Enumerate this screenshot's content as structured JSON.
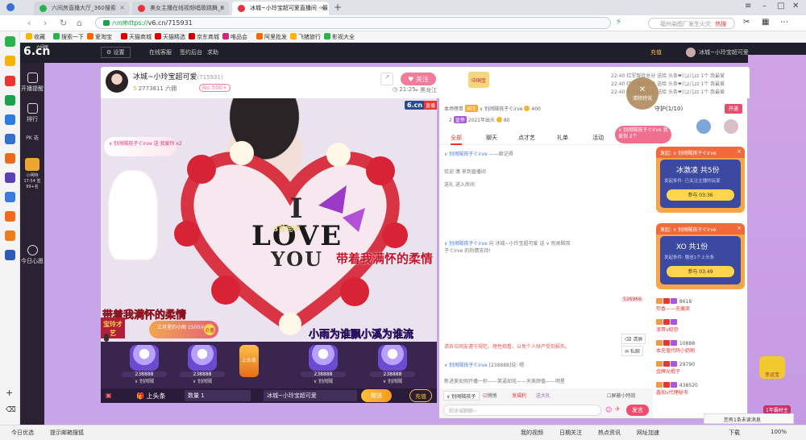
{
  "browser": {
    "tabs": [
      {
        "label": "六间房直播大厅_360搜索",
        "icon_color": "#2bb24c",
        "close": "×"
      },
      {
        "label": "美女主播在线视频唱歌跳舞_6",
        "icon_color": "#e8333a",
        "close": "×"
      },
      {
        "label": "冰城~小玲宝超可爱直播间 - 最",
        "icon_color": "#e8333a",
        "close": "×"
      }
    ],
    "new_tab": "+",
    "url_host": "https://",
    "url_rest": "v6.cn/715931",
    "site_tag": "六间房",
    "search_placeholder": "福州染图厂发生火灾",
    "search_hot": "热搜",
    "bookmarks": [
      "收藏",
      "搜索一下",
      "爱淘宝",
      "天猫商城",
      "天猫精选",
      "京东商城",
      "唯品会",
      "阿里批发",
      "飞猪旅行",
      "影视大全"
    ],
    "status": {
      "left": [
        "今日优选",
        "提示邮箱搜狐"
      ],
      "right": [
        "我的视频",
        "日期关注",
        "热点资讯",
        "网址加速",
        "下载",
        "100%"
      ]
    },
    "accent": "#2bb24c"
  },
  "site": {
    "logo": "6.cn",
    "logo_small": "六间房",
    "settings": "设置",
    "nav": [
      "在线客服",
      "签约后台",
      "求助"
    ],
    "user_right": [
      "充值",
      "冰城~小玲宝超可爱"
    ],
    "left_nav": [
      "开播提醒",
      "排行",
      "PK 选",
      "小明特 17:54 签99+名",
      "今日心愿"
    ],
    "anchor": {
      "name": "冰城~小玲宝超可爱",
      "id": "(715931)",
      "level": "5",
      "rank_text": "2773811 六佣",
      "fans": "No.500+",
      "follow": "关注",
      "time": "21:25",
      "location": "黑龙江"
    },
    "country_badge": "中国宝",
    "feed": [
      {
        "time": "22:40",
        "text": "红军叛徒总分 送给 头条❤儿z儿zz 1个 我最爱"
      },
      {
        "time": "22:40",
        "text": "红军叛徒总分 送给 头条❤儿z儿zz 1个 我最爱"
      },
      {
        "time": "22:40",
        "text": "红军叛徒总分 送给 头条❤儿z儿zz 1个 我最爱"
      }
    ],
    "video": {
      "stream_logo": "6.cn",
      "live": "直播",
      "gift_banner": "∨ 别闹贼孩子ぐirve 送 我爱你 x2",
      "overlay_banner": "3首完毕",
      "love_line1": "I",
      "love_line2": "LOVE",
      "love_line3": "YOU",
      "lyric_red": "带着我满怀的柔情",
      "lyric_gold": "带着我满怀的柔情",
      "lyric_yellow": "小雨为谁飘小溪为谁流",
      "brand": "宝玲才艺",
      "song_chip": "三月里的小雨 1500元/首",
      "song_pick": "点播"
    },
    "gifts": [
      {
        "num": "238888",
        "name": "∨ 别闹贼"
      },
      {
        "num": "238888",
        "name": "∨ 别闹贼"
      },
      {
        "num": "238888",
        "name": "∨ 别闹贼"
      },
      {
        "num": "238888",
        "name": "∨ 别闹贼"
      }
    ],
    "toplist_btn": "上头条",
    "gift_controls": {
      "headline": "上头条",
      "qty_label": "数量",
      "qty": "1",
      "target": "冰城~小玲宝超可爱",
      "send": "赠送",
      "recharge": "充值"
    },
    "chat": {
      "ranks": [
        {
          "tag": "本场榜单",
          "badge": "国王",
          "user": "∨ 别闹贼孩子ぐirve",
          "coins": "400"
        },
        {
          "tag": "2",
          "badge": "皇帝",
          "user": "2021年出头",
          "coins": "80"
        }
      ],
      "tabs": [
        "全部",
        "聊天",
        "点才艺",
        "礼单",
        "活动"
      ],
      "messages": [
        {
          "name": "∨ 别闹贼孩子ぐirve",
          "text": "——邮记得"
        },
        {
          "name": "",
          "text": "欢迎 潇 来到直播间"
        },
        {
          "name": "",
          "text": "送礼 进入房间"
        },
        {
          "name": "∨ 别闹贼孩子ぐirve",
          "text": "向 冰城~小玲宝超可爱 送 ∨ 别闹贼孩子ぐirve 的热情支持!"
        },
        {
          "name": "526966",
          "text": ""
        },
        {
          "name": "",
          "text": "请各位网友遵守规范，理性观看，以免个人财产受到损失。"
        },
        {
          "name": "∨ 别闹贼孩子ぐirve",
          "text": "[238888]说: 嗯"
        },
        {
          "name": "",
          "text": "新进美女刚开播一秒——笑逼如花——天美颜值——明星"
        }
      ],
      "tools": [
        "清屏",
        "私聊"
      ],
      "whisper_target": "∨ 别闹贼孩子",
      "whisper_chk": "悄悄",
      "shield": "屏蔽小特效",
      "input_placeholder": "和冰城聊聊~",
      "send": "发言",
      "hongbao": "发福利",
      "hongbao2": "送大礼"
    },
    "right": {
      "guard_header": "守护(1/10)",
      "guard_btn": "开通",
      "red1": {
        "head": "发起: ∨ 别闹贼孩子ぐirve",
        "title": "冰激凌 共5份",
        "sub": "发起条件: 已关注主播的玩家",
        "btn": "参与 03:36",
        "close": "×"
      },
      "red2": {
        "head": "发起: ∨ 别闹贼孩子ぐirve",
        "title": "XO 共1份",
        "sub": "发起条件: 赠送1个上头条",
        "btn": "参与 03:49",
        "close": "×"
      },
      "fans": [
        {
          "num": "8618",
          "name": "菸香——无痛哭"
        },
        {
          "num": "",
          "name": "浪哥v奴怨"
        },
        {
          "num": "10888",
          "name": "本充值代码小奶刷"
        },
        {
          "num": "29790",
          "name": "金牌光棍子"
        },
        {
          "num": "438520",
          "name": "鑫如v代理秘书"
        }
      ],
      "close_fx": "清除特效",
      "pink_msg": "∨ 别闹贼孩子ぐirve 我爱你 2个",
      "bottom_tip": "您有1条未读消息",
      "gem_label": "幸运宝",
      "bag_label": "1年霸材主"
    }
  }
}
